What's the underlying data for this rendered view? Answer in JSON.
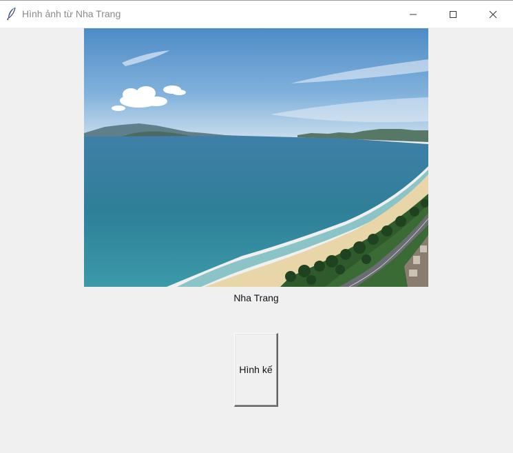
{
  "window": {
    "title": "Hình ảnh từ Nha Trang",
    "app_icon": "feather-icon",
    "controls": [
      "minimize-icon",
      "maximize-icon",
      "close-icon"
    ]
  },
  "main": {
    "image_alt": "Nha Trang",
    "caption": "Nha Trang",
    "next_button_label": "Hình kế"
  },
  "colors": {
    "window_bg": "#f0f0f0",
    "titlebar_bg": "#ffffff",
    "title_text": "#8a8a8a",
    "sky": "#5f9bd1",
    "sea": "#2f7f98",
    "sand": "#e8d5a8"
  }
}
